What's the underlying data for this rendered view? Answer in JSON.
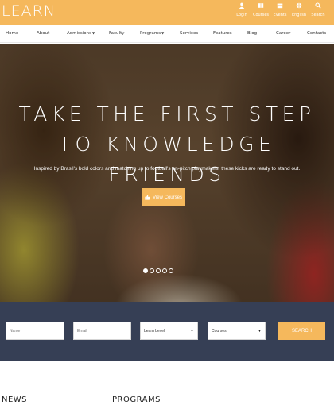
{
  "brand": {
    "logo_text": "LEARN",
    "accent_color": "#f5b85c",
    "band_color": "#363f55"
  },
  "top_links": [
    {
      "label": "Login",
      "icon": "user-icon"
    },
    {
      "label": "Courses",
      "icon": "book-icon"
    },
    {
      "label": "Events",
      "icon": "calendar-icon"
    },
    {
      "label": "English",
      "icon": "globe-icon"
    },
    {
      "label": "Search",
      "icon": "search-icon"
    }
  ],
  "nav": {
    "items": [
      {
        "label": "Home"
      },
      {
        "label": "About"
      },
      {
        "label": "Admissions",
        "dropdown": true
      },
      {
        "label": "Faculty"
      },
      {
        "label": "Programs",
        "dropdown": true
      },
      {
        "label": "Services"
      },
      {
        "label": "Features"
      },
      {
        "label": "Blog"
      },
      {
        "label": "Career"
      },
      {
        "label": "Contacts"
      }
    ]
  },
  "hero": {
    "title_line1": "TAKE THE FIRST STEP",
    "title_line2": "TO KNOWLEDGE FRIENDS",
    "subtitle": "Inspired by Brasil's bold colors and matching up to football's on-pitch playmakers, these kicks are ready to stand out.",
    "button_label": "View Courses",
    "button_icon": "thumbs-up-icon",
    "slides": 5,
    "active_slide": 1
  },
  "search": {
    "name_placeholder": "Name",
    "email_placeholder": "Email",
    "level_select": "Learn Level",
    "courses_select": "Courses",
    "button_label": "SEARCH"
  },
  "sections": {
    "news_heading": "NEWS",
    "programs_heading": "PROGRAMS"
  }
}
